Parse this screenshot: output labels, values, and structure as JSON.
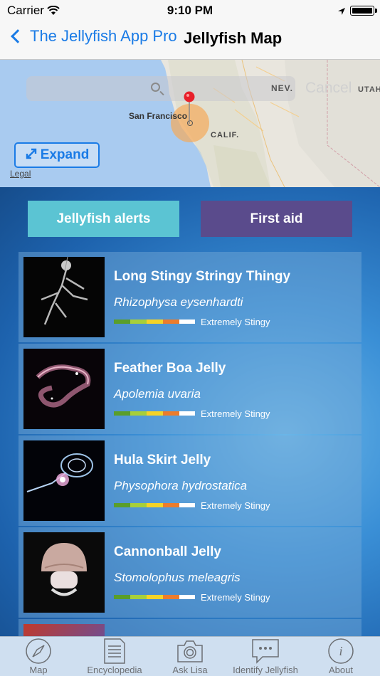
{
  "status": {
    "carrier": "Carrier",
    "time": "9:10 PM"
  },
  "nav": {
    "back_label": "The Jellyfish App Pro",
    "title": "Jellyfish Map"
  },
  "map": {
    "search_placeholder": "",
    "cancel_label": "Cancel",
    "labels": {
      "nev": "NEV.",
      "utah": "UTAH",
      "calif": "CALIF.",
      "city": "San Francisco"
    },
    "expand_label": "Expand",
    "legal_label": "Legal"
  },
  "actions": {
    "alerts_label": "Jellyfish alerts",
    "first_aid_label": "First aid"
  },
  "sting_scale_colors": [
    "#5a9e2a",
    "#a7cf3a",
    "#f5d327",
    "#ec7c2b",
    "#ffffff"
  ],
  "jellyfish": [
    {
      "name": "Long Stingy Stringy Thingy",
      "scientific": "Rhizophysa eysenhardti",
      "level": "Extremely Stingy",
      "icon": "rhizophysa-photo"
    },
    {
      "name": "Feather Boa Jelly",
      "scientific": "Apolemia uvaria",
      "level": "Extremely Stingy",
      "icon": "apolemia-photo"
    },
    {
      "name": "Hula Skirt Jelly",
      "scientific": "Physophora hydrostatica",
      "level": "Extremely Stingy",
      "icon": "physophora-photo"
    },
    {
      "name": "Cannonball Jelly",
      "scientific": "Stomolophus meleagris",
      "level": "Extremely Stingy",
      "icon": "stomolophus-photo"
    }
  ],
  "tabs": [
    {
      "label": "Map",
      "icon": "compass-icon"
    },
    {
      "label": "Encyclopedia",
      "icon": "document-icon"
    },
    {
      "label": "Ask Lisa",
      "icon": "camera-icon"
    },
    {
      "label": "Identify Jellyfish",
      "icon": "chat-bubble-icon"
    },
    {
      "label": "About",
      "icon": "info-icon"
    }
  ]
}
